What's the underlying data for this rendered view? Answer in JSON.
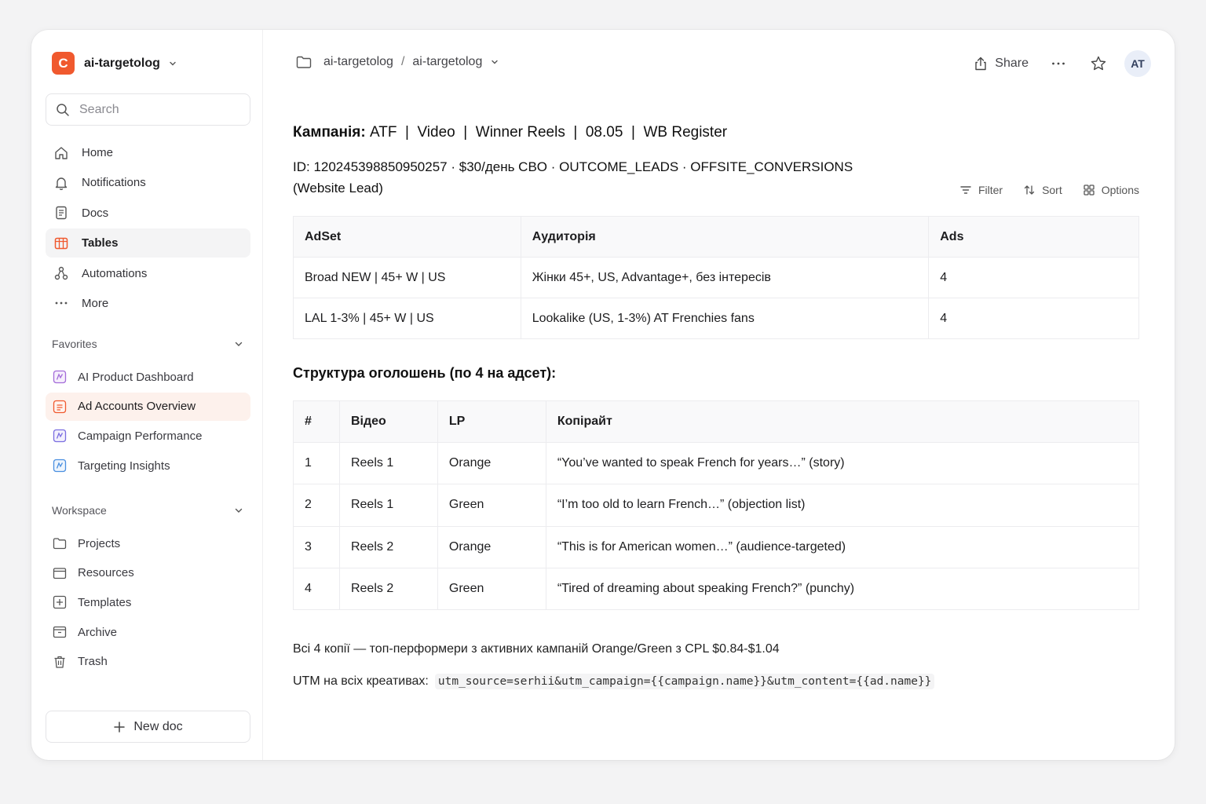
{
  "workspace": {
    "logo_letter": "C",
    "name": "ai-targetolog"
  },
  "search": {
    "placeholder": "Search"
  },
  "nav": [
    {
      "label": "Home",
      "icon": "home-icon"
    },
    {
      "label": "Notifications",
      "icon": "bell-icon"
    },
    {
      "label": "Docs",
      "icon": "doc-icon"
    },
    {
      "label": "Tables",
      "icon": "table-icon",
      "active": true
    },
    {
      "label": "Automations",
      "icon": "automations-icon"
    },
    {
      "label": "More",
      "icon": "more-icon"
    }
  ],
  "favorites": {
    "title": "Favorites",
    "items": [
      {
        "label": "AI Product Dashboard",
        "color": "#a36bd9"
      },
      {
        "label": "Ad Accounts Overview",
        "color": "#f0592e",
        "active": true
      },
      {
        "label": "Campaign Performance",
        "color": "#7a6de0"
      },
      {
        "label": "Targeting Insights",
        "color": "#4a8fe0"
      }
    ]
  },
  "workspace_section": {
    "title": "Workspace",
    "items": [
      {
        "label": "Projects",
        "icon": "folder-icon"
      },
      {
        "label": "Resources",
        "icon": "resources-icon"
      },
      {
        "label": "Templates",
        "icon": "templates-icon"
      },
      {
        "label": "Archive",
        "icon": "archive-icon"
      },
      {
        "label": "Trash",
        "icon": "trash-icon"
      }
    ]
  },
  "new_doc": {
    "label": "New doc"
  },
  "breadcrumb": {
    "part1": "ai-targetolog",
    "sep": "/",
    "part2": "ai-targetolog"
  },
  "actions": {
    "share": "Share",
    "avatar": "AT"
  },
  "campaign": {
    "title_label": "Кампанія:",
    "title_rest": " ATF  |  Video  |  Winner Reels  |  08.05  |  WB Register",
    "id_line": "ID: 120245398850950257 · $30/день CBO · OUTCOME_LEADS · OFFSITE_CONVERSIONS (Website Lead)"
  },
  "toolbar": {
    "filter": "Filter",
    "sort": "Sort",
    "options": "Options"
  },
  "adsets_table": {
    "headers": [
      "AdSet",
      "Аудиторія",
      "Ads"
    ],
    "rows": [
      [
        "Broad NEW | 45+ W | US",
        "Жінки 45+, US, Advantage+, без інтересів",
        "4"
      ],
      [
        "LAL 1-3% | 45+ W | US",
        "Lookalike (US, 1-3%) AT Frenchies fans",
        "4"
      ]
    ]
  },
  "structure_heading": "Структура оголошень (по 4 на адсет):",
  "ads_table": {
    "headers": [
      "#",
      "Відео",
      "LP",
      "Копірайт"
    ],
    "rows": [
      [
        "1",
        "Reels 1",
        "Orange",
        "“You’ve wanted to speak French for years…” (story)"
      ],
      [
        "2",
        "Reels 1",
        "Green",
        "“I’m too old to learn French…” (objection list)"
      ],
      [
        "3",
        "Reels 2",
        "Orange",
        "“This is for American women…” (audience-targeted)"
      ],
      [
        "4",
        "Reels 2",
        "Green",
        "“Tired of dreaming about speaking French?” (punchy)"
      ]
    ]
  },
  "footnote": "Всі 4 копії — топ-перформери з активних кампаній Orange/Green з CPL $0.84-$1.04",
  "utm": {
    "label": "UTM на всіх креативах:",
    "code": "utm_source=serhii&utm_campaign={{campaign.name}}&utm_content={{ad.name}}"
  }
}
